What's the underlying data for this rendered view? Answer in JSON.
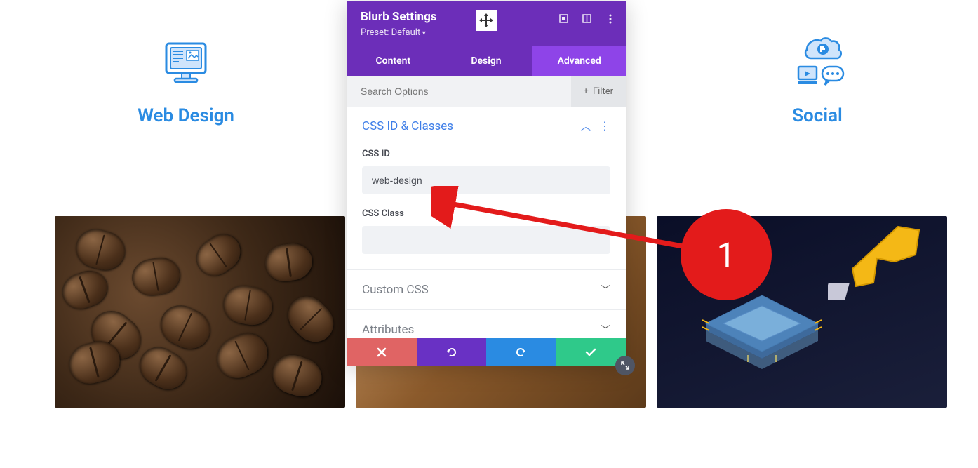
{
  "blurbs": {
    "left": {
      "title": "Web Design"
    },
    "right": {
      "title": "Social"
    }
  },
  "modal": {
    "title": "Blurb Settings",
    "preset": "Preset: Default",
    "tabs": {
      "content": "Content",
      "design": "Design",
      "advanced": "Advanced"
    },
    "search": {
      "placeholder": "Search Options",
      "filter_label": "Filter"
    },
    "sections": {
      "css_id_classes": {
        "title": "CSS ID & Classes",
        "css_id_label": "CSS ID",
        "css_id_value": "web-design",
        "css_class_label": "CSS Class",
        "css_class_value": ""
      },
      "custom_css": {
        "title": "Custom CSS"
      },
      "attributes": {
        "title": "Attributes"
      }
    }
  },
  "annotation": {
    "number": "1"
  }
}
